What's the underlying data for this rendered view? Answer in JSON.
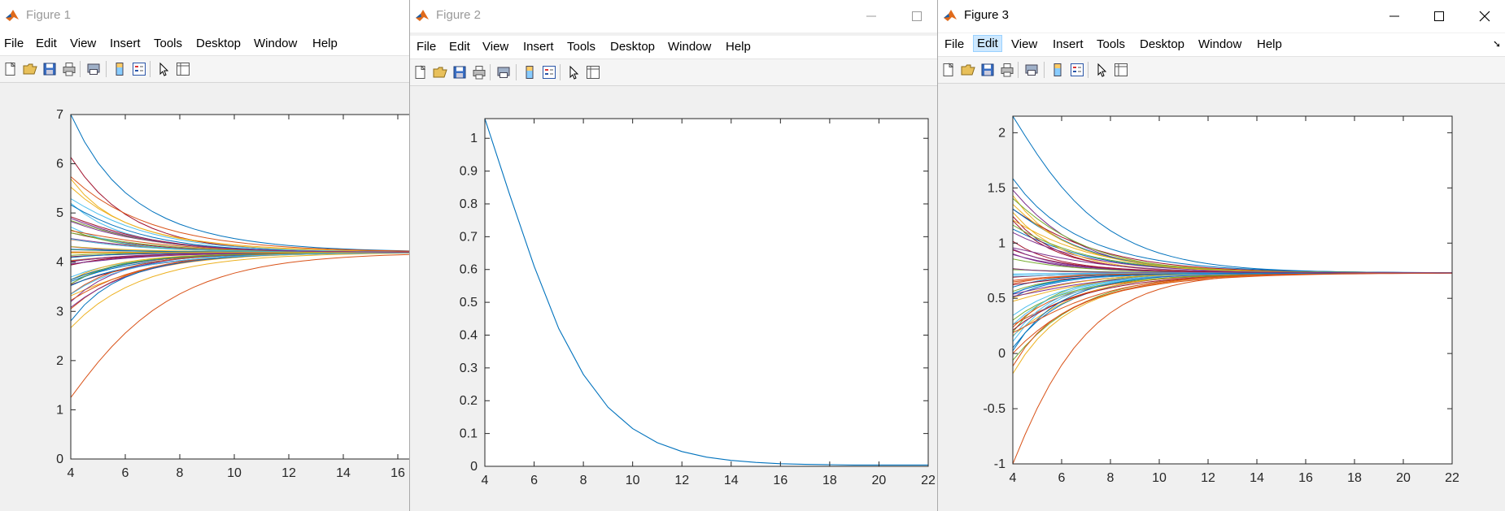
{
  "menu_items": [
    "File",
    "Edit",
    "View",
    "Insert",
    "Tools",
    "Desktop",
    "Window",
    "Help"
  ],
  "toolbar_tools": [
    "new-figure-icon",
    "open-file-icon",
    "save-icon",
    "print-icon",
    "print-preview-icon",
    "colorbar-icon",
    "legend-icon",
    "pointer-icon",
    "property-editor-icon"
  ],
  "accent_color": "#0072bd",
  "series_colors": [
    "#0072bd",
    "#d95319",
    "#edb120",
    "#7e2f8e",
    "#77ac30",
    "#4dbeee",
    "#a2142f"
  ],
  "figures": [
    {
      "title": "Figure 1",
      "chart_data": {
        "type": "line",
        "title": "",
        "xlabel": "",
        "ylabel": "",
        "xlim": [
          4,
          18
        ],
        "ylim": [
          0,
          7
        ],
        "x_ticks": [
          4,
          6,
          8,
          10,
          12,
          14,
          16
        ],
        "y_ticks": [
          0,
          1,
          2,
          3,
          4,
          5,
          6,
          7
        ],
        "converge_to": 4.2,
        "x_start": 4,
        "x_end": 18,
        "series_count": 60,
        "start_values_min": 1.25,
        "start_values_max": 7.0
      }
    },
    {
      "title": "Figure 2",
      "chart_data": {
        "type": "line",
        "title": "",
        "xlabel": "",
        "ylabel": "",
        "xlim": [
          4,
          22
        ],
        "ylim": [
          0,
          1.06
        ],
        "x_ticks": [
          4,
          6,
          8,
          10,
          12,
          14,
          16,
          18,
          20,
          22
        ],
        "y_ticks": [
          0,
          0.1,
          0.2,
          0.3,
          0.4,
          0.5,
          0.6,
          0.7,
          0.8,
          0.9,
          1
        ],
        "series": [
          {
            "x": [
              4,
              5,
              6,
              7,
              8,
              9,
              10,
              11,
              12,
              13,
              14,
              15,
              16,
              17,
              18,
              19,
              20,
              21,
              22
            ],
            "values": [
              1.06,
              0.83,
              0.61,
              0.42,
              0.28,
              0.18,
              0.115,
              0.072,
              0.045,
              0.028,
              0.018,
              0.012,
              0.008,
              0.006,
              0.005,
              0.004,
              0.004,
              0.004,
              0.004
            ]
          }
        ]
      }
    },
    {
      "title": "Figure 3",
      "chart_data": {
        "type": "line",
        "title": "",
        "xlabel": "",
        "ylabel": "",
        "xlim": [
          4,
          22
        ],
        "ylim": [
          -1,
          2.15
        ],
        "x_ticks": [
          4,
          6,
          8,
          10,
          12,
          14,
          16,
          18,
          20,
          22
        ],
        "y_ticks": [
          -1,
          -0.5,
          0,
          0.5,
          1,
          1.5,
          2
        ],
        "converge_to": 0.73,
        "x_start": 4,
        "x_end": 22,
        "series_count": 60,
        "start_values_min": -1.0,
        "start_values_max": 2.15
      }
    }
  ]
}
